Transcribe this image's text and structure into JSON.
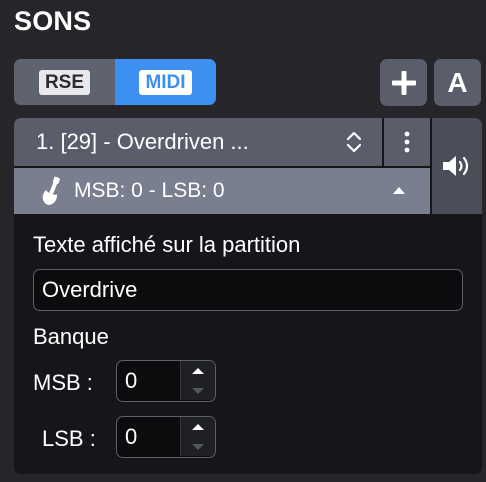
{
  "header": {
    "title": "SONS"
  },
  "mode_toggle": {
    "rse_label": "RSE",
    "midi_label": "MIDI",
    "selected": "MIDI"
  },
  "toolbar": {
    "add_label": "+",
    "a_label": "A"
  },
  "sound": {
    "name": "1. [29] - Overdriven ..."
  },
  "bank_row": {
    "text": "MSB: 0 - LSB: 0"
  },
  "form": {
    "display_text_label": "Texte affiché sur la partition",
    "display_text_value": "Overdrive",
    "bank_label": "Banque",
    "msb_label": "MSB :",
    "msb_value": "0",
    "lsb_label": "LSB :",
    "lsb_value": "0"
  },
  "colors": {
    "accent": "#3d8ff0",
    "panel": "#16161a",
    "button": "#5a5e6a",
    "background": "#26262a"
  },
  "icons": [
    "plus-icon",
    "letter-a-icon",
    "up-down-icon",
    "kebab-icon",
    "speaker-icon",
    "guitar-icon",
    "caret-up-icon"
  ]
}
